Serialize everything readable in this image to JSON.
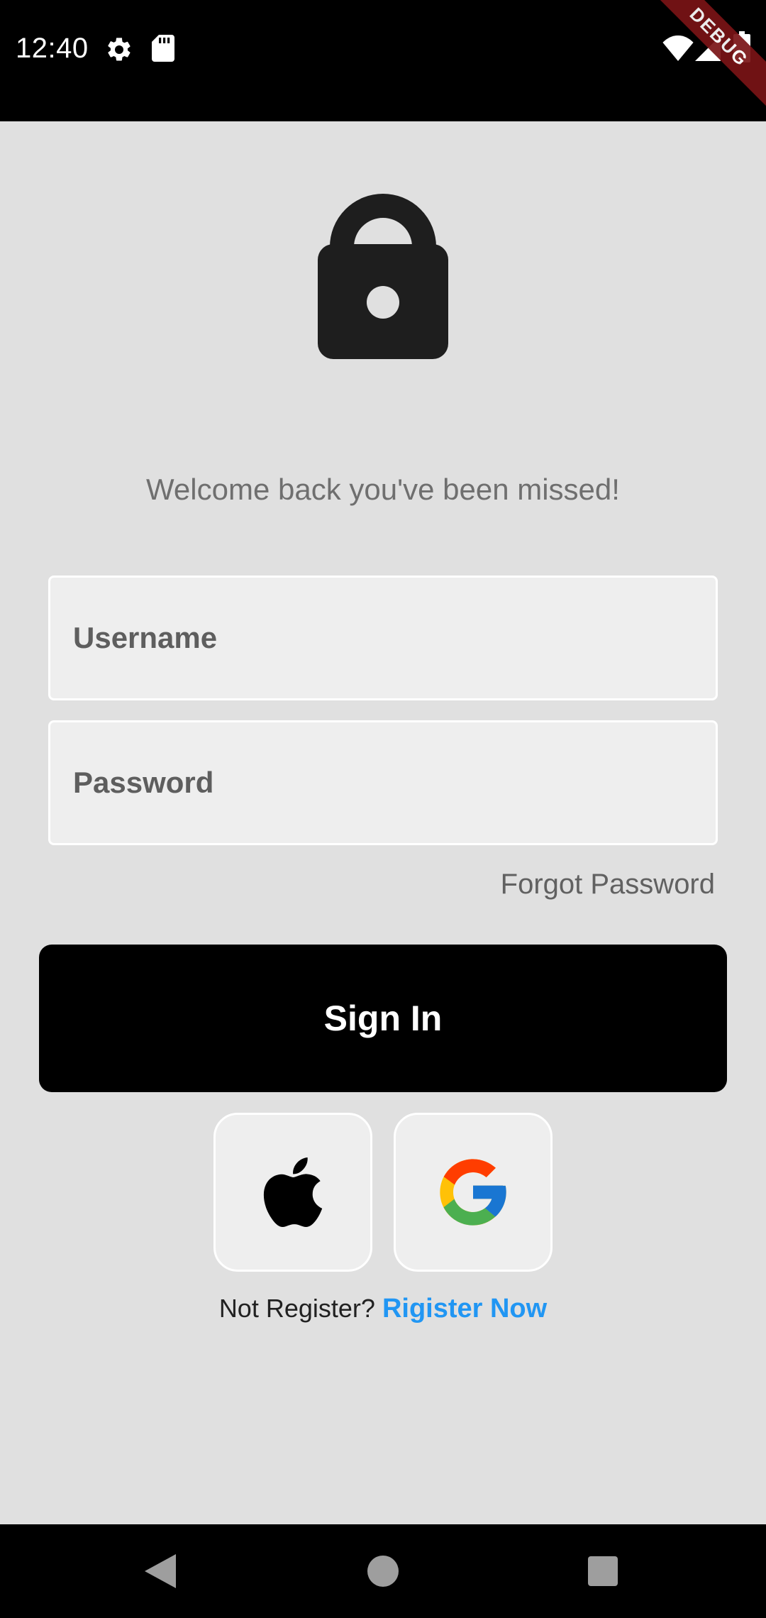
{
  "status_bar": {
    "time": "12:40",
    "icons": [
      "settings-icon",
      "sd-card-icon",
      "wifi-icon",
      "signal-icon",
      "battery-icon"
    ],
    "debug_banner": "DEBUG"
  },
  "main": {
    "header_icon": "lock-icon",
    "welcome_text": "Welcome back you've been missed!",
    "username_placeholder": "Username",
    "password_placeholder": "Password",
    "forgot_password": "Forgot Password",
    "sign_in_label": "Sign In",
    "social_buttons": [
      "apple-logo-icon",
      "google-logo-icon"
    ],
    "register_prompt": "Not Register?",
    "register_link": "Rigister Now"
  },
  "nav_bar": {
    "buttons": [
      "back-icon",
      "home-icon",
      "recents-icon"
    ]
  },
  "colors": {
    "background": "#e0e0e0",
    "primary_button": "#000000",
    "link": "#2196f3",
    "debug_banner": "#7a1416"
  }
}
